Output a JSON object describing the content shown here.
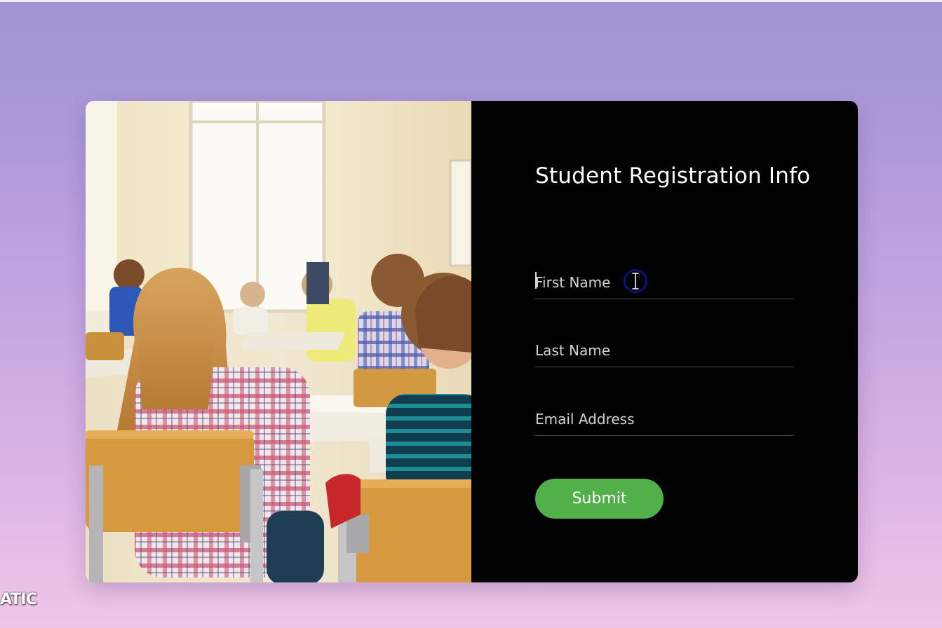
{
  "form": {
    "title": "Student Registration Info",
    "fields": [
      {
        "placeholder": "First Name",
        "value": ""
      },
      {
        "placeholder": "Last Name",
        "value": ""
      },
      {
        "placeholder": "Email Address",
        "value": ""
      }
    ],
    "submit_label": "Submit"
  },
  "watermark": {
    "text": "ATIC"
  },
  "colors": {
    "page_gradient_top": "#9f93d5",
    "page_gradient_bottom": "#efc6e8",
    "panel_background": "#010101",
    "submit_button": "#51b04a",
    "cursor_ring": "#0b1278"
  },
  "icons": [
    "text-cursor-icon"
  ]
}
